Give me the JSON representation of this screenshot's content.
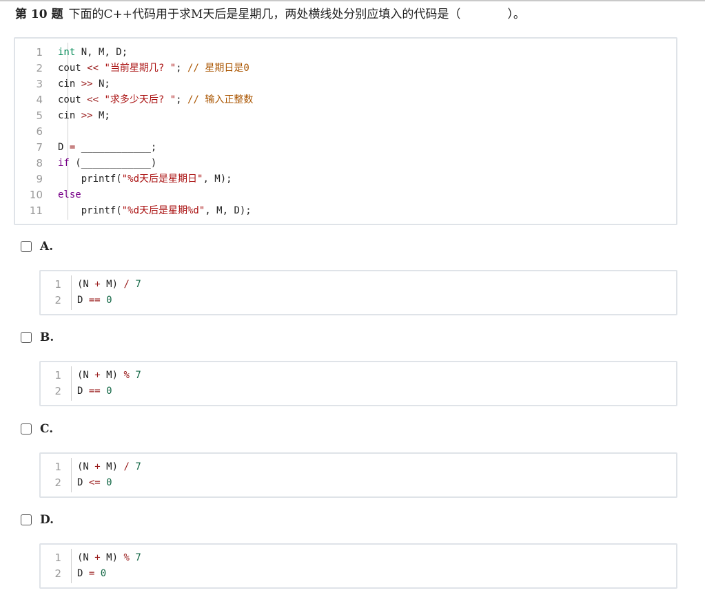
{
  "question": {
    "number": "第 10 题",
    "text": "下面的C++代码用于求M天后是星期几，两处横线处分别应填入的代码是（　　　　）。"
  },
  "main_code": [
    {
      "n": "1",
      "parts": [
        [
          "kw",
          "int"
        ],
        [
          "p",
          " N, M, D;"
        ]
      ]
    },
    {
      "n": "2",
      "parts": [
        [
          "p",
          "cout "
        ],
        [
          "op",
          "<<"
        ],
        [
          "p",
          " "
        ],
        [
          "str",
          "\"当前星期几? \""
        ],
        [
          "p",
          "; "
        ],
        [
          "cm",
          "// 星期日是0"
        ]
      ]
    },
    {
      "n": "3",
      "parts": [
        [
          "p",
          "cin "
        ],
        [
          "op",
          ">>"
        ],
        [
          "p",
          " N;"
        ]
      ]
    },
    {
      "n": "4",
      "parts": [
        [
          "p",
          "cout "
        ],
        [
          "op",
          "<<"
        ],
        [
          "p",
          " "
        ],
        [
          "str",
          "\"求多少天后? \""
        ],
        [
          "p",
          "; "
        ],
        [
          "cm",
          "// 输入正整数"
        ]
      ]
    },
    {
      "n": "5",
      "parts": [
        [
          "p",
          "cin "
        ],
        [
          "op",
          ">>"
        ],
        [
          "p",
          " M;"
        ]
      ]
    },
    {
      "n": "6",
      "parts": []
    },
    {
      "n": "7",
      "parts": [
        [
          "p",
          "D "
        ],
        [
          "op",
          "="
        ],
        [
          "p",
          " ____________;"
        ]
      ]
    },
    {
      "n": "8",
      "parts": [
        [
          "kw2",
          "if"
        ],
        [
          "p",
          " (____________)"
        ]
      ]
    },
    {
      "n": "9",
      "parts": [
        [
          "p",
          "    printf("
        ],
        [
          "str",
          "\"%d天后是星期日\""
        ],
        [
          "p",
          ", M);"
        ]
      ]
    },
    {
      "n": "10",
      "parts": [
        [
          "kw2",
          "else"
        ]
      ]
    },
    {
      "n": "11",
      "parts": [
        [
          "p",
          "    printf("
        ],
        [
          "str",
          "\"%d天后是星期%d\""
        ],
        [
          "p",
          ", M, D);"
        ]
      ]
    }
  ],
  "options": [
    {
      "label": "A.",
      "lines": [
        {
          "n": "1",
          "parts": [
            [
              "p",
              "(N "
            ],
            [
              "op",
              "+"
            ],
            [
              "p",
              " M) "
            ],
            [
              "op",
              "/"
            ],
            [
              "p",
              " "
            ],
            [
              "num",
              "7"
            ]
          ]
        },
        {
          "n": "2",
          "parts": [
            [
              "p",
              "D "
            ],
            [
              "op",
              "=="
            ],
            [
              "p",
              " "
            ],
            [
              "num",
              "0"
            ]
          ]
        }
      ]
    },
    {
      "label": "B.",
      "lines": [
        {
          "n": "1",
          "parts": [
            [
              "p",
              "(N "
            ],
            [
              "op",
              "+"
            ],
            [
              "p",
              " M) "
            ],
            [
              "op",
              "%"
            ],
            [
              "p",
              " "
            ],
            [
              "num",
              "7"
            ]
          ]
        },
        {
          "n": "2",
          "parts": [
            [
              "p",
              "D "
            ],
            [
              "op",
              "=="
            ],
            [
              "p",
              " "
            ],
            [
              "num",
              "0"
            ]
          ]
        }
      ]
    },
    {
      "label": "C.",
      "lines": [
        {
          "n": "1",
          "parts": [
            [
              "p",
              "(N "
            ],
            [
              "op",
              "+"
            ],
            [
              "p",
              " M) "
            ],
            [
              "op",
              "/"
            ],
            [
              "p",
              " "
            ],
            [
              "num",
              "7"
            ]
          ]
        },
        {
          "n": "2",
          "parts": [
            [
              "p",
              "D "
            ],
            [
              "op",
              "<="
            ],
            [
              "p",
              " "
            ],
            [
              "num",
              "0"
            ]
          ]
        }
      ]
    },
    {
      "label": "D.",
      "lines": [
        {
          "n": "1",
          "parts": [
            [
              "p",
              "(N "
            ],
            [
              "op",
              "+"
            ],
            [
              "p",
              " M) "
            ],
            [
              "op",
              "%"
            ],
            [
              "p",
              " "
            ],
            [
              "num",
              "7"
            ]
          ]
        },
        {
          "n": "2",
          "parts": [
            [
              "p",
              "D "
            ],
            [
              "op",
              "="
            ],
            [
              "p",
              " "
            ],
            [
              "num",
              "0"
            ]
          ]
        }
      ]
    }
  ],
  "icons": {
    "checkbox": "checkbox-empty-icon"
  }
}
